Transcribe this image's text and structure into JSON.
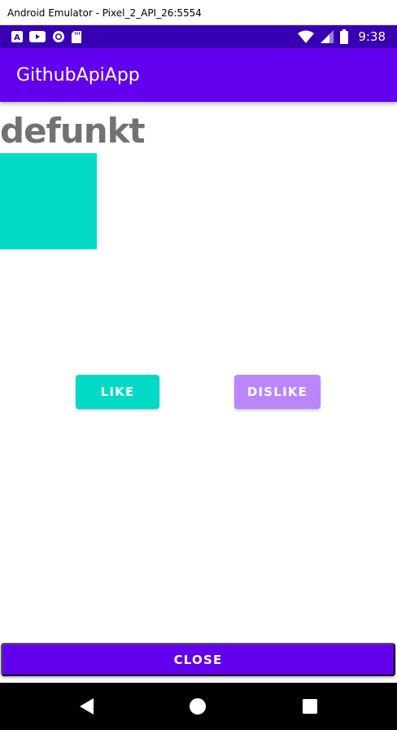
{
  "window": {
    "title": "Android Emulator - Pixel_2_API_26:5554"
  },
  "status_bar": {
    "time": "9:38",
    "left_icons": [
      "a-icon",
      "youtube-icon",
      "record-icon",
      "sd-card-icon"
    ],
    "right_icons": [
      "wifi-icon",
      "signal-icon",
      "battery-icon"
    ],
    "background": "#3700b3"
  },
  "app_bar": {
    "title": "GithubApiApp",
    "background": "#6200ee"
  },
  "profile": {
    "username": "defunkt",
    "avatar_color": "#03dac5"
  },
  "actions": {
    "like_label": "LIKE",
    "like_color": "#03dac5",
    "dislike_label": "DISLIKE",
    "dislike_color": "#bb86fc",
    "close_label": "CLOSE",
    "close_color": "#6200ee"
  },
  "nav_bar": {
    "buttons": [
      "back-icon",
      "home-icon",
      "recents-icon"
    ]
  }
}
